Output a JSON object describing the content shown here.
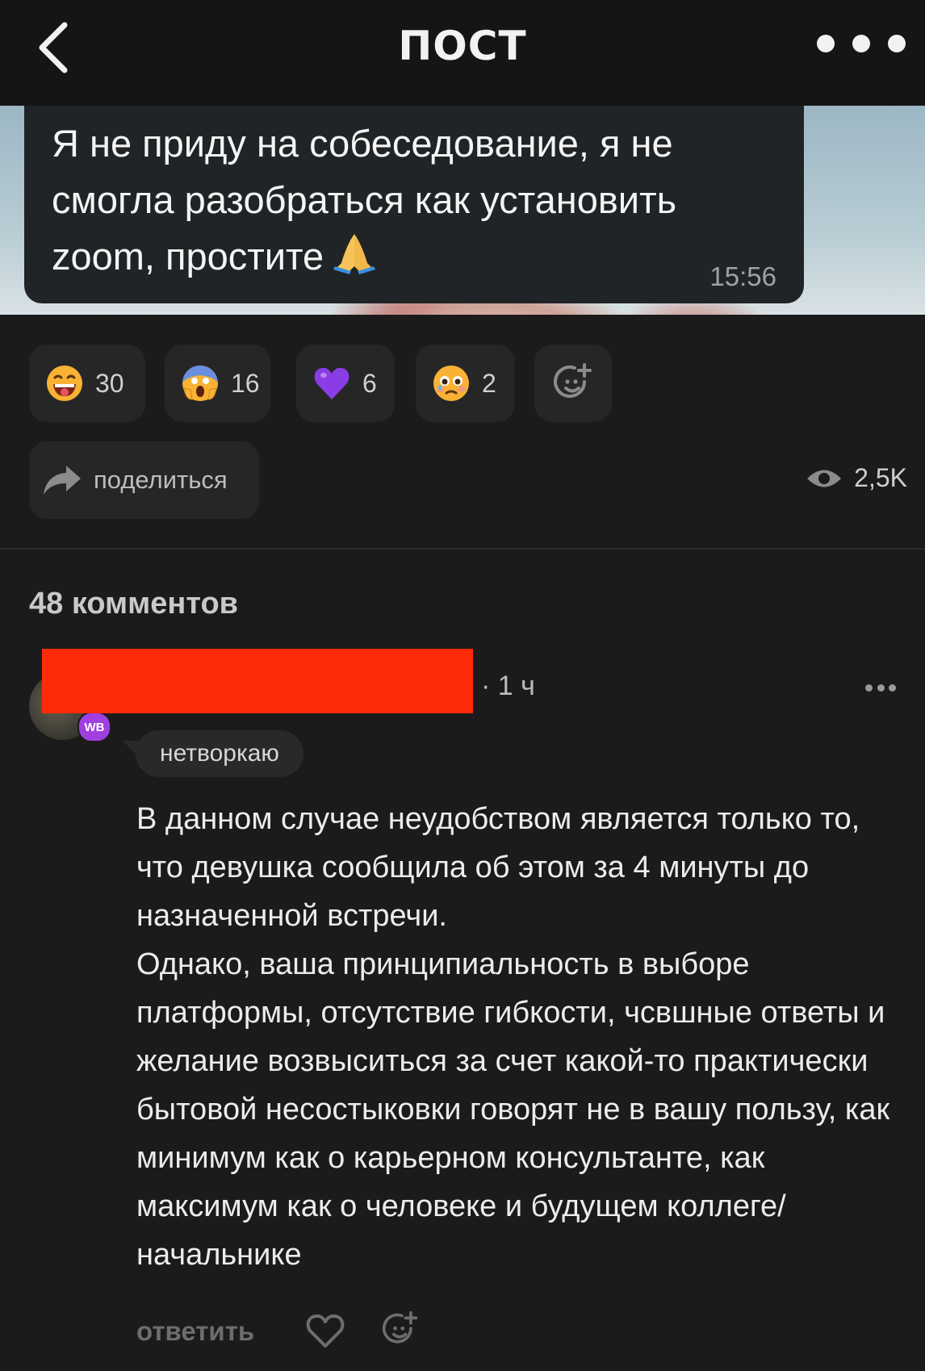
{
  "header": {
    "title": "ПОСТ",
    "back_icon": "chevron-left-icon",
    "more_icon": "more-horizontal-icon"
  },
  "post": {
    "message_text": "Я не приду на собеседование, я не смогла разобраться как установить zoom, простите",
    "message_emoji": "folded-hands-emoji",
    "message_time": "15:56"
  },
  "reactions": [
    {
      "emoji": "grinning-face-emoji",
      "count": "30"
    },
    {
      "emoji": "screaming-face-emoji",
      "count": "16"
    },
    {
      "emoji": "purple-heart-emoji",
      "count": "6"
    },
    {
      "emoji": "holding-back-tears-emoji",
      "count": "2"
    }
  ],
  "actions": {
    "share_label": "поделиться",
    "views_count": "2,5K"
  },
  "comments": {
    "title": "48 комментов",
    "items": [
      {
        "badge": "WB",
        "time": "· 1 ч",
        "tag": "нетворкаю",
        "text": "В данном случае неудобством является только то, что девушка сообщила об этом за 4 минуты до назначенной встречи.\nОднако, ваша принципиальность в выборе платформы, отсутствие гибкости, чсвшные ответы и желание возвыситься за счет какой-то практически бытовой несостыковки говорят не в вашу пользу, как минимум как о карьерном консультанте, как максимум как о человеке и будущем коллеге/начальнике",
        "reply_label": "ответить"
      }
    ]
  },
  "colors": {
    "background": "#1b1b1c",
    "header": "#151516",
    "chip": "#262627",
    "redaction": "#ff2a08",
    "badge": "#a03fe0"
  }
}
